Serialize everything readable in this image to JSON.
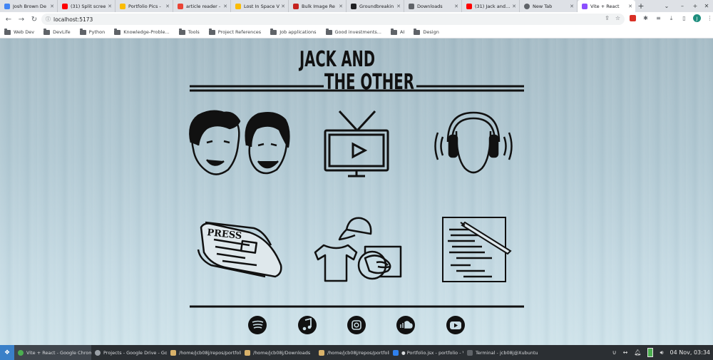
{
  "browser": {
    "tabs": [
      {
        "label": "Josh Brown De",
        "color": "#4285f4"
      },
      {
        "label": "(31) Split scree",
        "color": "#ff0000"
      },
      {
        "label": "Portfolio Pics -",
        "color": "#fbbc04"
      },
      {
        "label": "article reader -",
        "color": "#ea4335"
      },
      {
        "label": "Lost In Space V",
        "color": "#fbbc04"
      },
      {
        "label": "Bulk Image Re",
        "color": "#c5221f"
      },
      {
        "label": "Groundbreakin",
        "color": "#202124"
      },
      {
        "label": "Downloads",
        "color": "#5f6368"
      },
      {
        "label": "(31) Jack and th",
        "color": "#ff0000"
      },
      {
        "label": "New Tab",
        "color": "#5f6368"
      },
      {
        "label": "Vite + React",
        "color": "#8c4fff",
        "active": true
      }
    ],
    "new_tab_symbol": "+",
    "url": "localhost:5173",
    "avatar_letter": "J",
    "bookmarks": [
      "Web Dev",
      "DevLife",
      "Python",
      "Knowledge-Proble...",
      "Tools",
      "Project References",
      "Job applications",
      "Good investments...",
      "AI",
      "Design"
    ]
  },
  "site": {
    "title_line1": "JACK AND",
    "title_line2": "THE OTHER",
    "press_label": "PRESS",
    "icons": [
      "band-photo-icon",
      "video-tv-icon",
      "headphones-listen-icon",
      "press-newspaper-icon",
      "merch-icon",
      "writing-notepad-icon"
    ],
    "social": [
      "spotify-icon",
      "music-note-icon",
      "instagram-icon",
      "soundcloud-icon",
      "youtube-icon"
    ]
  },
  "taskbar": {
    "items": [
      {
        "label": "Vite + React - Google Chrome",
        "active": true
      },
      {
        "label": "Projects - Google Drive - Go..."
      },
      {
        "label": "/home/jcb08j/repos/portfoli..."
      },
      {
        "label": "/home/jcb08j/Downloads"
      },
      {
        "label": "/home/jcb08j/repos/portfoli..."
      },
      {
        "label": "● Portfolio.jsx - portfolio - Vi..."
      },
      {
        "label": "Terminal - jcb08j@Xubuntu: ..."
      }
    ],
    "clock": "04 Nov, 03:34"
  },
  "colors": {
    "ink": "#111111",
    "page_top": "#a6bcc6",
    "page_bottom": "#cfe3ea",
    "taskbar": "#2b2f33"
  }
}
